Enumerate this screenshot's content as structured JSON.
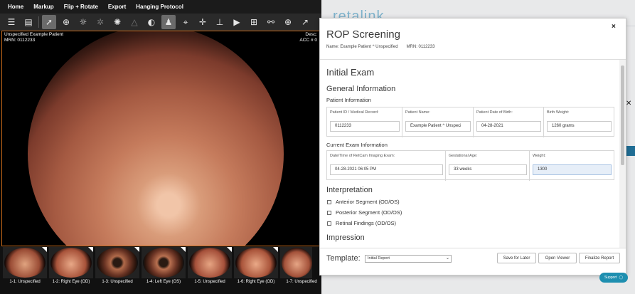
{
  "viewer": {
    "menu": [
      "Home",
      "Markup",
      "Flip + Rotate",
      "Export",
      "Hanging Protocol"
    ],
    "tools": [
      "list-icon",
      "document-icon",
      "magnify-icon",
      "brightness-icon",
      "contrast-icon",
      "sun-icon",
      "triangle-icon",
      "invert-icon",
      "pointer-icon",
      "crosshair-icon",
      "plus-icon",
      "anvil-icon",
      "play-icon",
      "layout-icon",
      "link-icon",
      "zoom-icon",
      "arrow-icon"
    ],
    "patient_name": "Unspecified Example Patient",
    "mrn": "MRN: 0112233",
    "desc": "Desc:",
    "acc": "ACC # 0",
    "thumbnails": [
      {
        "label": "1-1: Unspecified"
      },
      {
        "label": "1-2: Right Eye (OD)"
      },
      {
        "label": "1-3: Unspecified"
      },
      {
        "label": "1-4: Left Eye (OS)"
      },
      {
        "label": "1-5: Unspecified"
      },
      {
        "label": "1-6: Right Eye (OD)"
      },
      {
        "label": "1-7: Unspecified"
      }
    ]
  },
  "background": {
    "logo": "retalink"
  },
  "modal": {
    "title": "ROP Screening",
    "name_label": "Name: Example Patient ^ Unspecified",
    "mrn_label": "MRN: 0112233",
    "section_title": "Initial Exam",
    "general_info": "General Information",
    "patient_info": "Patient Information",
    "patient_fields": [
      {
        "label": "Patient ID / Medical Record:",
        "value": "0112233"
      },
      {
        "label": "Patient Name:",
        "value": "Example Patient ^ Unspeci"
      },
      {
        "label": "Patient Date of Birth:",
        "value": "04-28-2021"
      },
      {
        "label": "Birth Weight:",
        "value": "1260 grams"
      }
    ],
    "current_exam": "Current Exam Information",
    "exam_fields": [
      {
        "label": "Date/Time of RetCam Imaging Exam:",
        "value": "04-28-2021 06:05 PM"
      },
      {
        "label": "Gestational Age:",
        "value": "33 weeks"
      },
      {
        "label": "Weight:",
        "value": "1300"
      }
    ],
    "interpretation": "Interpretation",
    "checks": [
      "Anterior Segment (OD/OS)",
      "Posterior Segment (OD/OS)",
      "Retinal Findings (OD/OS)"
    ],
    "impression": "Impression",
    "template_label": "Template:",
    "template_value": "Initial Report",
    "buttons": {
      "save": "Save for Later",
      "open": "Open Viewer",
      "finalize": "Finalize Report"
    },
    "close": "×"
  },
  "support": "Support"
}
